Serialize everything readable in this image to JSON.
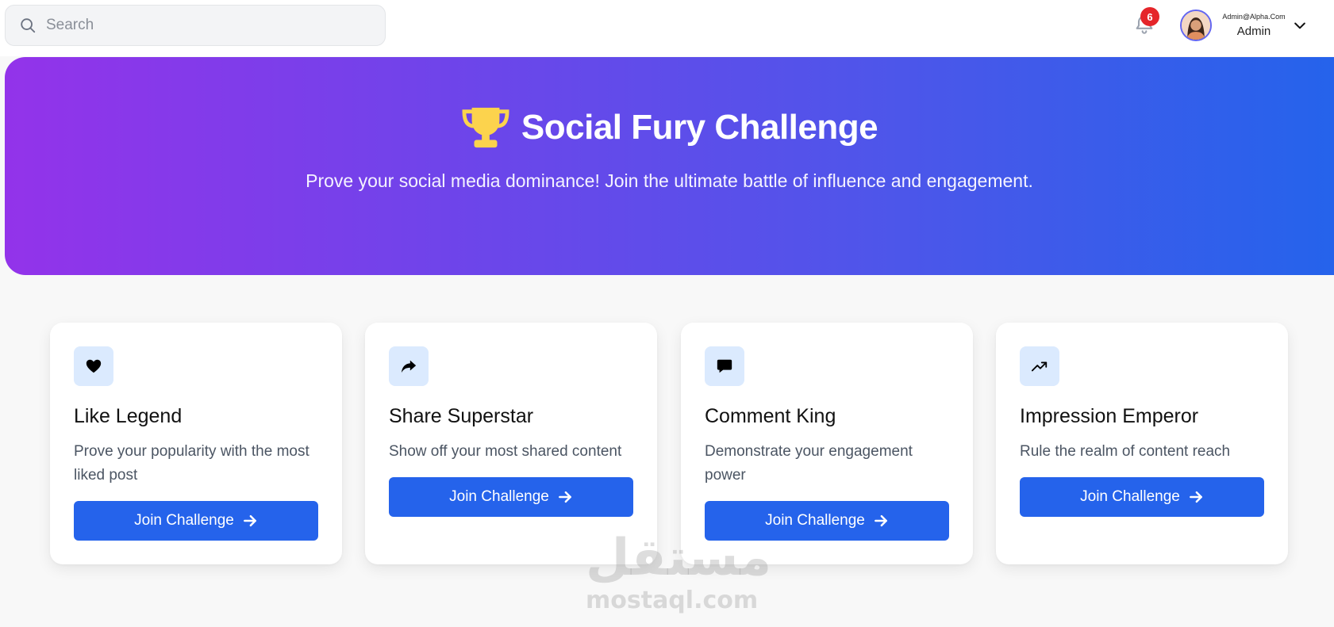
{
  "header": {
    "search": {
      "placeholder": "Search",
      "value": ""
    },
    "notifications": {
      "count": "6"
    },
    "user": {
      "email": "Admin@Alpha.Com",
      "name": "Admin"
    }
  },
  "hero": {
    "title": "Social Fury Challenge",
    "subtitle": "Prove your social media dominance! Join the ultimate battle of influence and engagement."
  },
  "cards": [
    {
      "icon": "heart-icon",
      "title": "Like Legend",
      "description": "Prove your popularity with the most liked post",
      "button_label": "Join Challenge"
    },
    {
      "icon": "share-icon",
      "title": "Share Superstar",
      "description": "Show off your most shared content",
      "button_label": "Join Challenge"
    },
    {
      "icon": "comment-icon",
      "title": "Comment King",
      "description": "Demonstrate your engagement power",
      "button_label": "Join Challenge"
    },
    {
      "icon": "trending-up-icon",
      "title": "Impression Emperor",
      "description": "Rule the realm of content reach",
      "button_label": "Join Challenge"
    }
  ],
  "watermark": {
    "arabic": "مستقل",
    "latin": "mostaql.com"
  },
  "colors": {
    "accent": "#2563eb",
    "hero_gradient_start": "#9333ea",
    "hero_gradient_end": "#2563eb",
    "badge": "#e5252a",
    "trophy": "#fcd34d",
    "icon_bg": "#dbeafe"
  }
}
